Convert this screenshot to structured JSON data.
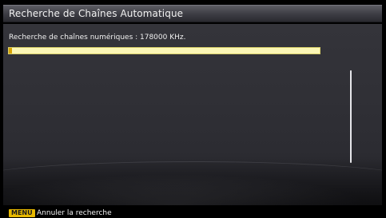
{
  "header": {
    "title": "Recherche de Chaînes Automatique"
  },
  "scan": {
    "status_text": "Recherche de chaînes numériques : 178000 KHz.",
    "progress_fraction": 0.01
  },
  "footer": {
    "key": "MENU",
    "action_label": "Annuler la recherche"
  },
  "colors": {
    "progress_track": "#fbf6b5",
    "progress_fill": "#d9a400",
    "key_badge": "#e8b900"
  }
}
